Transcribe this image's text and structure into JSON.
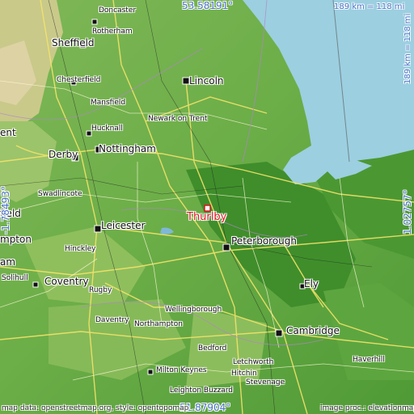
{
  "map": {
    "marker_color": "#e0141e",
    "sea_color": "#9ccfe0",
    "land_color": "#5a9e3c",
    "highlight_place": "Thurlby",
    "coordinates": {
      "top": "53.58191°",
      "bottom": "51.87904°",
      "left": "-1.78493°",
      "right": "1.02757°"
    },
    "scale_horizontal": "189 km = 118 mi",
    "scale_vertical": "189 km = 118 mi",
    "credit_left": "map data: openstreetmap.org, style: opentopomap",
    "credit_right": "image proc.: elevationmap"
  },
  "places": {
    "doncaster": "Doncaster",
    "rotherham": "Rotherham",
    "sheffield": "Sheffield",
    "chesterfield": "Chesterfield",
    "lincoln": "Lincoln",
    "mansfield": "Mansfield",
    "newark": "Newark on Trent",
    "hucknall": "Hucknall",
    "nottingham": "Nottingham",
    "derby": "Derby",
    "swadlincote": "Swadlincote",
    "thurlby": "Thurlby",
    "leicester": "Leicester",
    "peterborough": "Peterborough",
    "hinckley": "Hinckley",
    "coventry": "Coventry",
    "rugby": "Rugby",
    "solihull": "Solihull",
    "ely": "Ely",
    "wellingborough": "Wellingborough",
    "daventry": "Daventry",
    "northampton": "Northampton",
    "cambridge": "Cambridge",
    "bedford": "Bedford",
    "haverhill": "Haverhill",
    "milton_keynes": "Milton Keynes",
    "letchworth": "Letchworth",
    "leighton_buzzard": "Leighton Buzzard",
    "hitchin": "Hitchin",
    "stevenage": "Stevenage",
    "partial_ent": "ent",
    "partial_field": "field",
    "partial_mpton": "mpton",
    "partial_am": "am"
  }
}
